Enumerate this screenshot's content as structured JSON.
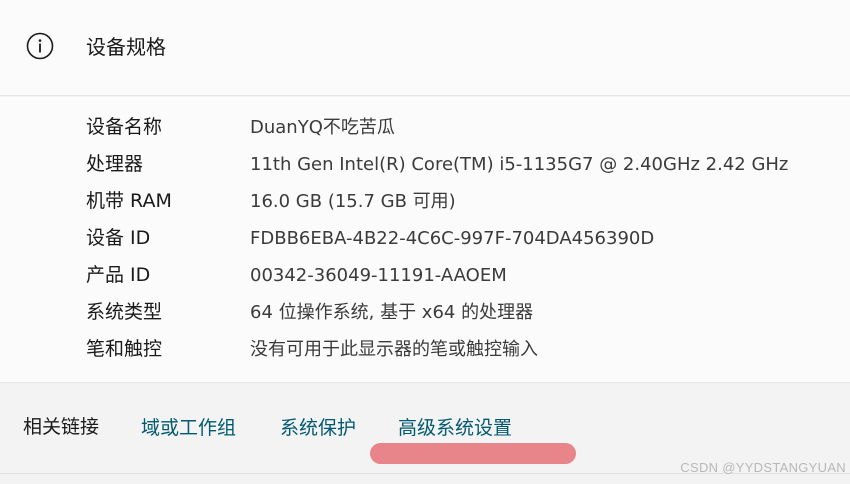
{
  "section": {
    "title": "设备规格",
    "icon": "info-icon"
  },
  "specs": [
    {
      "label": "设备名称",
      "value": "DuanYQ不吃苦瓜"
    },
    {
      "label": "处理器",
      "value": "11th Gen Intel(R) Core(TM) i5-1135G7 @ 2.40GHz   2.42 GHz"
    },
    {
      "label": "机带 RAM",
      "value": "16.0 GB (15.7 GB 可用)"
    },
    {
      "label": "设备 ID",
      "value": "FDBB6EBA-4B22-4C6C-997F-704DA456390D"
    },
    {
      "label": "产品 ID",
      "value": "00342-36049-11191-AAOEM"
    },
    {
      "label": "系统类型",
      "value": "64 位操作系统, 基于 x64 的处理器"
    },
    {
      "label": "笔和触控",
      "value": "没有可用于此显示器的笔或触控输入"
    }
  ],
  "related_links": {
    "label": "相关链接",
    "links": [
      "域或工作组",
      "系统保护",
      "高级系统设置"
    ]
  },
  "watermark": "CSDN @YYDSTANGYUAN",
  "colors": {
    "link": "#005a70",
    "highlight": "#e8858a",
    "card": "#fbfbfb",
    "background": "#f3f3f3"
  }
}
